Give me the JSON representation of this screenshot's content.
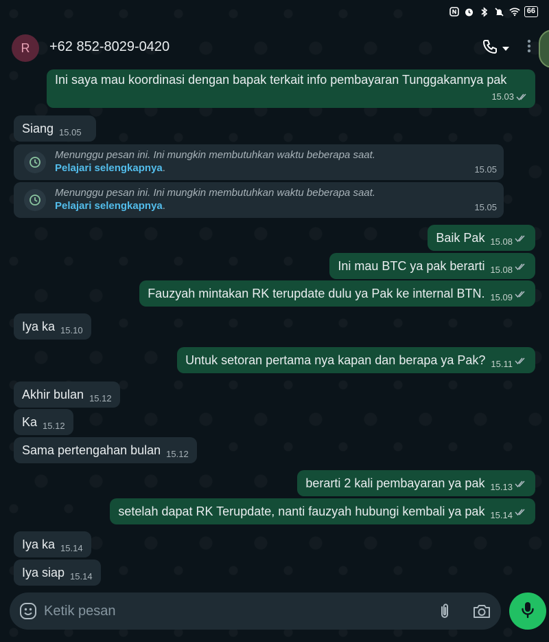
{
  "status": {
    "battery": "66"
  },
  "header": {
    "avatar_letter": "R",
    "contact": "+62 852-8029-0420"
  },
  "messages": [
    {
      "side": "out",
      "text": "Ini saya mau koordinasi dengan bapak terkait info pembayaran Tunggakannya pak",
      "time": "15.03"
    },
    {
      "side": "in",
      "text": "Siang",
      "time": "15.05"
    },
    {
      "side": "in",
      "text": "Iya ka",
      "time": "15.10"
    },
    {
      "side": "out",
      "text": "Baik Pak",
      "time": "15.08"
    },
    {
      "side": "out",
      "text": "Ini mau BTC ya pak berarti",
      "time": "15.08"
    },
    {
      "side": "out",
      "text": "Fauzyah mintakan RK terupdate dulu ya Pak ke internal BTN.",
      "time": "15.09"
    },
    {
      "side": "out",
      "text": "Untuk setoran pertama nya kapan dan berapa ya Pak?",
      "time": "15.11"
    },
    {
      "side": "in",
      "text": "Akhir bulan",
      "time": "15.12"
    },
    {
      "side": "in",
      "text": "Ka",
      "time": "15.12"
    },
    {
      "side": "in",
      "text": "Sama pertengahan bulan",
      "time": "15.12"
    },
    {
      "side": "out",
      "text": "berarti 2 kali pembayaran ya pak",
      "time": "15.13"
    },
    {
      "side": "out",
      "text": "setelah dapat RK Terupdate, nanti fauzyah hubungi kembali ya pak",
      "time": "15.14"
    },
    {
      "side": "in",
      "text": "Iya ka",
      "time": "15.14"
    },
    {
      "side": "in",
      "text": "Iya siap",
      "time": "15.14"
    }
  ],
  "pending": [
    {
      "text": "Menunggu pesan ini. Ini mungkin membutuhkan waktu beberapa saat.",
      "link": "Pelajari selengkapnya",
      "time": "15.05"
    },
    {
      "text": "Menunggu pesan ini. Ini mungkin membutuhkan waktu beberapa saat.",
      "link": "Pelajari selengkapnya",
      "time": "15.05"
    }
  ],
  "composer": {
    "placeholder": "Ketik pesan"
  },
  "colors": {
    "outgoing": "#144d37",
    "incoming": "#1f2c34",
    "accent": "#21c063",
    "link": "#53bdeb"
  },
  "icons": [
    "phone-icon",
    "chevron-down-icon",
    "more-vert-icon",
    "clock-icon",
    "emoji-icon",
    "attach-icon",
    "camera-icon",
    "mic-icon",
    "double-check-icon"
  ]
}
